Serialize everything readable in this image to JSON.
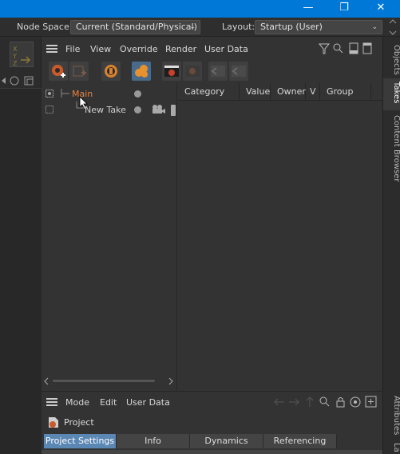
{
  "window": {
    "minimize_glyph": "—",
    "restore_glyph": "❐",
    "close_glyph": "✕",
    "accent": "#0078d7"
  },
  "nodebar": {
    "node_space_label": "Node Space:",
    "node_space_value": "Current (Standard/Physical)",
    "layout_label": "Layout:",
    "layout_value": "Startup (User)"
  },
  "left_panel": {
    "xyz_label": "XYZ"
  },
  "menubar": {
    "items": [
      "File",
      "View",
      "Override",
      "Render",
      "User Data"
    ]
  },
  "takes": {
    "main": "Main",
    "new_take": "New Take",
    "main_color": "#e8833a",
    "columns": [
      "Category",
      "Value",
      "Owner",
      "V",
      "Group Tag"
    ]
  },
  "right_tabs": {
    "objects": "Objects",
    "takes": "Takes",
    "content_browser": "Content Browser",
    "attributes": "Attributes",
    "layers": "La"
  },
  "attributes": {
    "menu": [
      "Mode",
      "Edit",
      "User Data"
    ],
    "project_label": "Project",
    "tabs": [
      "Project Settings",
      "Info",
      "Dynamics",
      "Referencing"
    ],
    "active_tab_color": "#5a87b4"
  }
}
